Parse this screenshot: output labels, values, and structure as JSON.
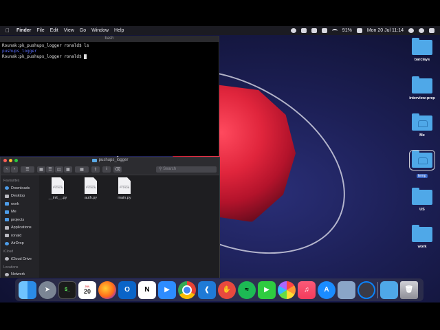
{
  "menubar": {
    "app": "Finder",
    "menus": [
      "File",
      "Edit",
      "View",
      "Go",
      "Window",
      "Help"
    ],
    "battery": "91%",
    "clock": "Mon 20 Jul  11:14"
  },
  "terminal": {
    "title": "bash",
    "lines": [
      {
        "prompt": "Rounak:pk_pushups_logger ronald$",
        "cmd": " ls"
      },
      {
        "output": "pushups_logger"
      },
      {
        "prompt": "Rounak:pk_pushups_logger ronald$",
        "cmd": " "
      }
    ]
  },
  "finder": {
    "title": "pushups_logger",
    "search_placeholder": "Search",
    "sidebar": {
      "favourites_header": "Favourites",
      "favourites": [
        "Downloads",
        "Desktop",
        "work",
        "Me",
        "projects",
        "Applications",
        "ronald",
        "AirDrop"
      ],
      "icloud_header": "iCloud",
      "icloud": [
        "iCloud Drive"
      ],
      "locations_header": "Locations",
      "locations": [
        "Network"
      ]
    },
    "file_tag": "PYTHON",
    "files": [
      "__init__.py",
      "auth.py",
      "main.py"
    ]
  },
  "desktop": {
    "icons": [
      "barclays",
      "interview-prep",
      "Me",
      "temp",
      "US",
      "work"
    ],
    "selected": "temp"
  },
  "dock": {
    "calendar_month": "JUL",
    "calendar_day": "20",
    "apps": [
      "finder-icon",
      "launchpad-icon",
      "terminal-icon",
      "calendar-icon",
      "firefox-icon",
      "outlook-icon",
      "notion-icon",
      "zoom-icon",
      "chrome-icon",
      "vscode-icon",
      "pushbullet-icon",
      "spotify-icon",
      "facetime-icon",
      "photos-icon",
      "music-icon",
      "app-store-icon",
      "preview-icon",
      "quicktime-icon",
      "downloads-folder-icon",
      "trash-icon"
    ]
  }
}
